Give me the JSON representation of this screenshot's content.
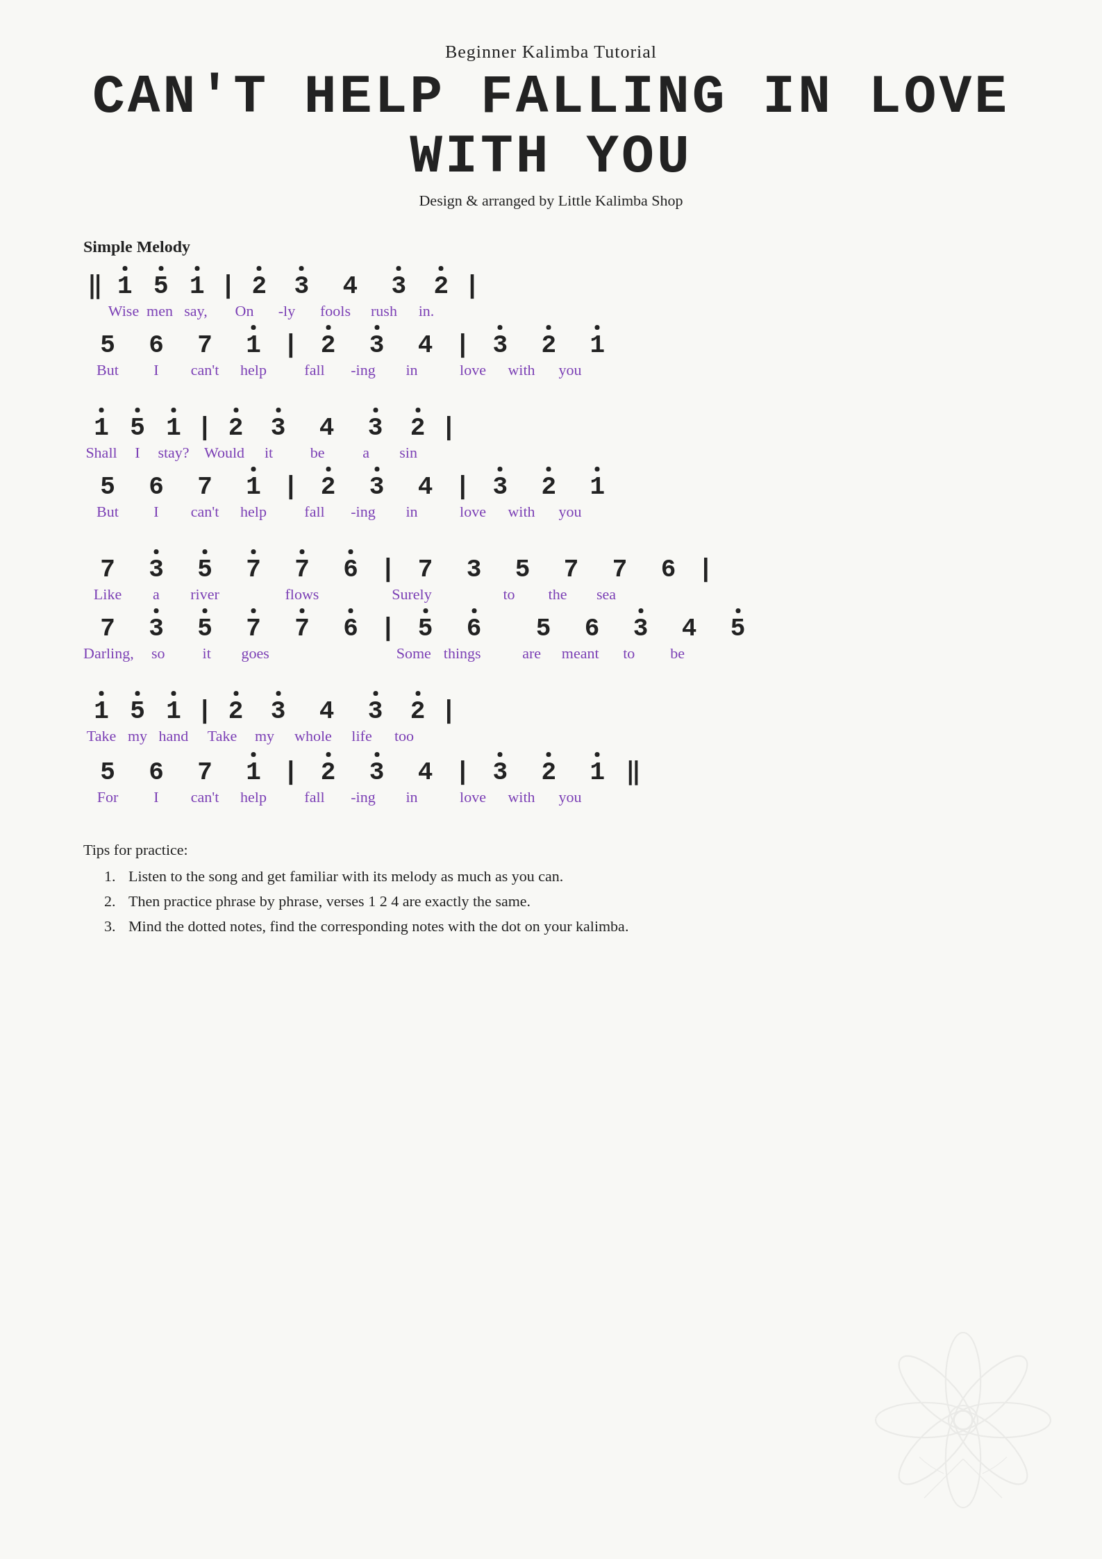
{
  "header": {
    "subtitle": "Beginner Kalimba Tutorial",
    "title": "CAN'T HELP FALLING IN LOVE WITH YOU",
    "arranger": "Design & arranged by Little Kalimba Shop"
  },
  "section_label": "Simple Melody",
  "tips": {
    "title": "Tips for practice:",
    "items": [
      "Listen to the song and get familiar with its melody as much as you can.",
      "Then practice phrase by phrase, verses 1 2 4 are exactly the same.",
      "Mind the dotted notes, find the corresponding notes with the dot on your kalimba."
    ]
  }
}
